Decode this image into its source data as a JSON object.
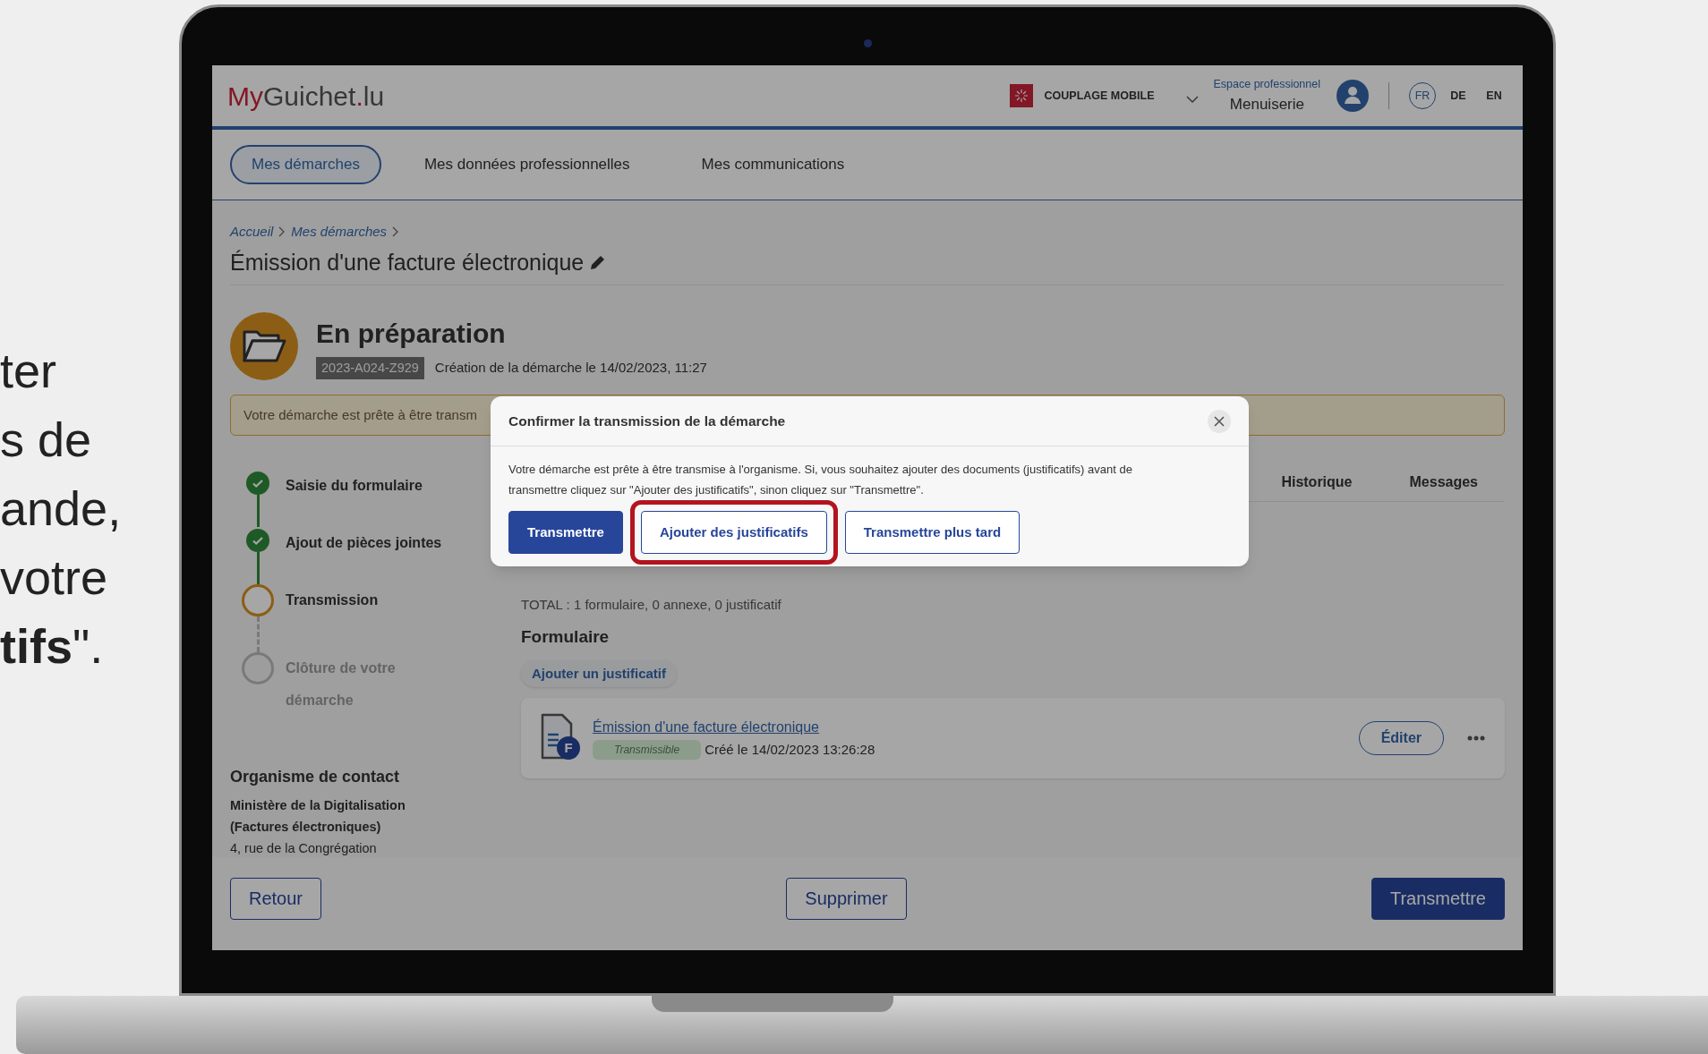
{
  "slide_text": [
    "ter",
    "s de",
    "ande,",
    "votre",
    "**tifs**\"."
  ],
  "header": {
    "logo_parts": [
      {
        "text": "My",
        "accent": true
      },
      {
        "text": "Guichet",
        "accent": false
      },
      {
        "text": ".",
        "accent": true
      },
      {
        "text": "lu",
        "accent": false
      }
    ],
    "coupling": "COUPLAGE MOBILE",
    "space_label": "Espace professionnel",
    "space_name": "Menuiserie",
    "languages": [
      {
        "label": "FR",
        "selected": true
      },
      {
        "label": "DE",
        "selected": false
      },
      {
        "label": "EN",
        "selected": false
      }
    ]
  },
  "nav": [
    {
      "label": "Mes démarches",
      "selected": true
    },
    {
      "label": "Mes données professionnelles",
      "selected": false
    },
    {
      "label": "Mes communications",
      "selected": false
    }
  ],
  "breadcrumb": [
    "Accueil",
    "Mes démarches"
  ],
  "title": "Émission d'une facture électronique",
  "status": {
    "title": "En préparation",
    "reference": "2023-A024-Z929",
    "created": "Création de la démarche le 14/02/2023, 11:27"
  },
  "alert": "Votre démarche est prête à être transm",
  "steps": [
    {
      "label": "Saisie du formulaire",
      "kind": "done"
    },
    {
      "label": "Ajout de pièces jointes",
      "kind": "done"
    },
    {
      "label": "Transmission",
      "kind": "current"
    },
    {
      "label": "Clôture de votre démarche",
      "kind": "pending"
    }
  ],
  "contact": {
    "heading": "Organisme de contact",
    "organisation": [
      "Ministère de la Digitalisation",
      "(Factures électroniques)"
    ],
    "address": "4, rue de la Congrégation"
  },
  "tabs": [
    {
      "label": "Historique",
      "selected": false
    },
    {
      "label": "Messages",
      "selected": false
    }
  ],
  "total": "TOTAL : 1 formulaire, 0 annexe, 0 justificatif",
  "section": {
    "title": "Formulaire",
    "add_button": "Ajouter un justificatif"
  },
  "form_item": {
    "badge_letter": "F",
    "title": "Émission d'une facture électronique",
    "status": "Transmissible",
    "created": "Créé le 14/02/2023 13:26:28",
    "edit": "Éditer"
  },
  "footer_buttons": [
    {
      "label": "Retour",
      "kind": "outline"
    },
    {
      "label": "Supprimer",
      "kind": "outline"
    },
    {
      "label": "Transmettre",
      "kind": "primary"
    }
  ],
  "modal": {
    "title": "Confirmer la transmission de la démarche",
    "message": "Votre démarche est prête à être transmise à l'organisme. Si, vous souhaitez ajouter des documents (justificatifs) avant de transmettre cliquez sur \"Ajouter des justificatifs\", sinon cliquez sur \"Transmettre\".",
    "buttons": [
      {
        "label": "Transmettre",
        "kind": "primary",
        "highlighted": false
      },
      {
        "label": "Ajouter des justificatifs",
        "kind": "outline",
        "highlighted": true
      },
      {
        "label": "Transmettre plus tard",
        "kind": "outline",
        "highlighted": false
      }
    ]
  }
}
